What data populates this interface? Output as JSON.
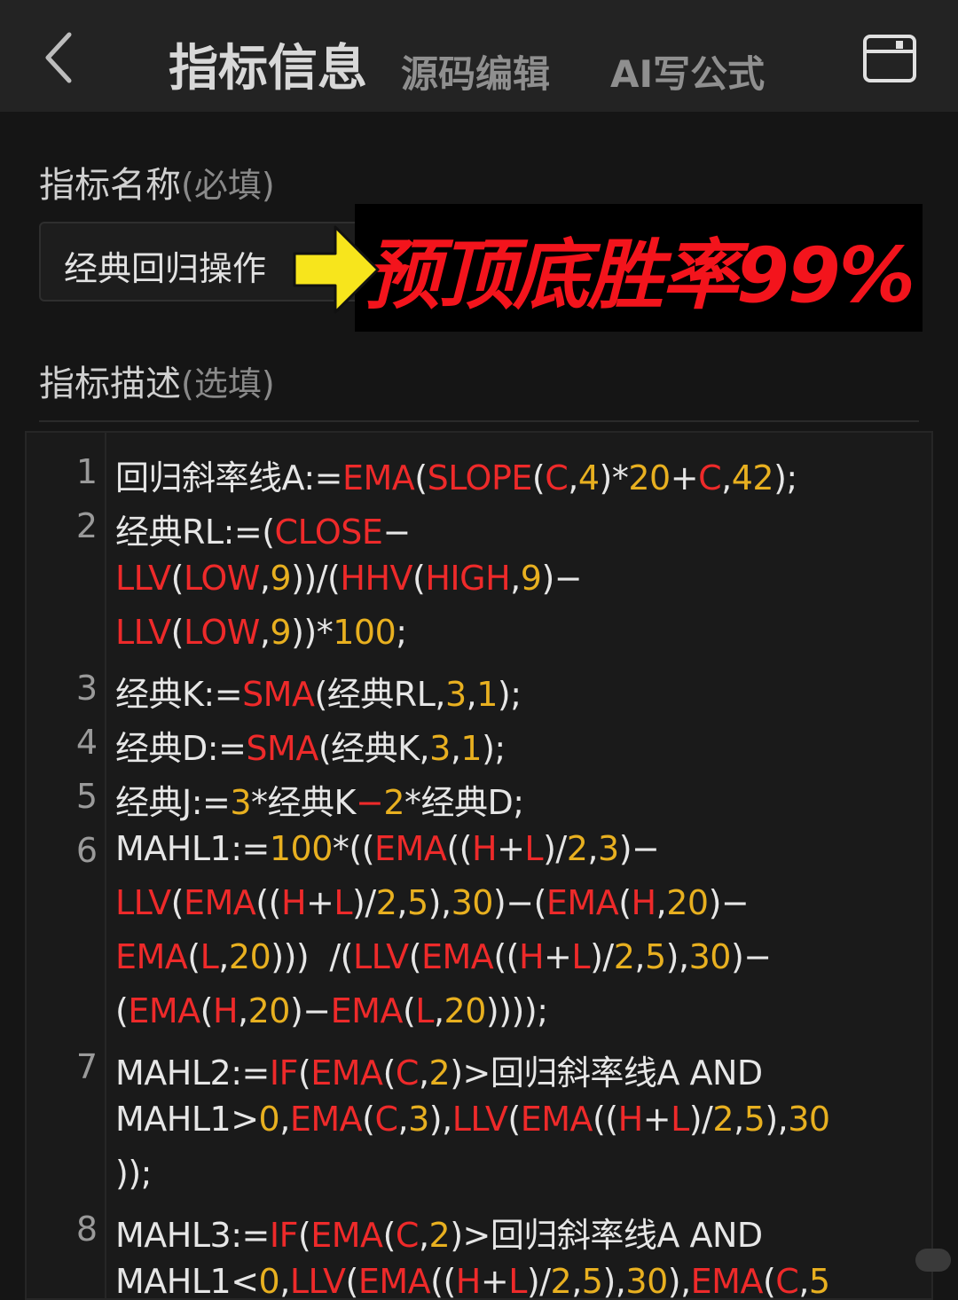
{
  "header": {
    "tabs": [
      "指标信息",
      "源码编辑",
      "AI写公式"
    ]
  },
  "form": {
    "name_label": "指标名称",
    "name_hint": "(必填)",
    "name_value": "经典回归操作",
    "desc_label": "指标描述",
    "desc_hint": "(选填)"
  },
  "banner": {
    "text": "预顶底胜率99%"
  },
  "colors": {
    "keyword": "#ee2a2a",
    "number": "#e8b020",
    "text": "#e6e6e6",
    "banner": "#f3141c",
    "arrow": "#f7e51c"
  },
  "code_lines": [
    {
      "ln": "1",
      "tokens": [
        [
          "w",
          "回归斜率线A:="
        ],
        [
          "r",
          "EMA"
        ],
        [
          "w",
          "("
        ],
        [
          "r",
          "SLOPE"
        ],
        [
          "w",
          "("
        ],
        [
          "r",
          "C"
        ],
        [
          "w",
          ","
        ],
        [
          "o",
          "4"
        ],
        [
          "w",
          ")*"
        ],
        [
          "o",
          "20"
        ],
        [
          "w",
          "+"
        ],
        [
          "r",
          "C"
        ],
        [
          "w",
          ","
        ],
        [
          "o",
          "42"
        ],
        [
          "w",
          ");"
        ]
      ]
    },
    {
      "ln": "2",
      "tokens": [
        [
          "w",
          "经典RL:=("
        ],
        [
          "r",
          "CLOSE"
        ],
        [
          "w",
          "−"
        ]
      ]
    },
    {
      "ln": "",
      "tokens": [
        [
          "r",
          "LLV"
        ],
        [
          "w",
          "("
        ],
        [
          "r",
          "LOW"
        ],
        [
          "w",
          ","
        ],
        [
          "o",
          "9"
        ],
        [
          "w",
          "))/("
        ],
        [
          "r",
          "HHV"
        ],
        [
          "w",
          "("
        ],
        [
          "r",
          "HIGH"
        ],
        [
          "w",
          ","
        ],
        [
          "o",
          "9"
        ],
        [
          "w",
          ")−"
        ]
      ]
    },
    {
      "ln": "",
      "tokens": [
        [
          "r",
          "LLV"
        ],
        [
          "w",
          "("
        ],
        [
          "r",
          "LOW"
        ],
        [
          "w",
          ","
        ],
        [
          "o",
          "9"
        ],
        [
          "w",
          "))*"
        ],
        [
          "o",
          "100"
        ],
        [
          "w",
          ";"
        ]
      ]
    },
    {
      "ln": "3",
      "tokens": [
        [
          "w",
          "经典K:="
        ],
        [
          "r",
          "SMA"
        ],
        [
          "w",
          "(经典RL,"
        ],
        [
          "o",
          "3"
        ],
        [
          "w",
          ","
        ],
        [
          "o",
          "1"
        ],
        [
          "w",
          ");"
        ]
      ]
    },
    {
      "ln": "4",
      "tokens": [
        [
          "w",
          "经典D:="
        ],
        [
          "r",
          "SMA"
        ],
        [
          "w",
          "(经典K,"
        ],
        [
          "o",
          "3"
        ],
        [
          "w",
          ","
        ],
        [
          "o",
          "1"
        ],
        [
          "w",
          ");"
        ]
      ]
    },
    {
      "ln": "5",
      "tokens": [
        [
          "w",
          "经典J:="
        ],
        [
          "o",
          "3"
        ],
        [
          "w",
          "*经典K"
        ],
        [
          "r",
          "−"
        ],
        [
          "o",
          "2"
        ],
        [
          "w",
          "*经典D;"
        ]
      ]
    },
    {
      "ln": "6",
      "tokens": [
        [
          "w",
          "MAHL1:="
        ],
        [
          "o",
          "100"
        ],
        [
          "w",
          "*(("
        ],
        [
          "r",
          "EMA"
        ],
        [
          "w",
          "(("
        ],
        [
          "r",
          "H"
        ],
        [
          "w",
          "+"
        ],
        [
          "r",
          "L"
        ],
        [
          "w",
          ")/"
        ],
        [
          "o",
          "2"
        ],
        [
          "w",
          ","
        ],
        [
          "o",
          "3"
        ],
        [
          "w",
          ")−"
        ]
      ]
    },
    {
      "ln": "",
      "tokens": [
        [
          "r",
          "LLV"
        ],
        [
          "w",
          "("
        ],
        [
          "r",
          "EMA"
        ],
        [
          "w",
          "(("
        ],
        [
          "r",
          "H"
        ],
        [
          "w",
          "+"
        ],
        [
          "r",
          "L"
        ],
        [
          "w",
          ")/"
        ],
        [
          "o",
          "2"
        ],
        [
          "w",
          ","
        ],
        [
          "o",
          "5"
        ],
        [
          "w",
          "),"
        ],
        [
          "o",
          "30"
        ],
        [
          "w",
          ")−("
        ],
        [
          "r",
          "EMA"
        ],
        [
          "w",
          "("
        ],
        [
          "r",
          "H"
        ],
        [
          "w",
          ","
        ],
        [
          "o",
          "20"
        ],
        [
          "w",
          ")−"
        ]
      ]
    },
    {
      "ln": "",
      "tokens": [
        [
          "r",
          "EMA"
        ],
        [
          "w",
          "("
        ],
        [
          "r",
          "L"
        ],
        [
          "w",
          ","
        ],
        [
          "o",
          "20"
        ],
        [
          "w",
          ")))  /("
        ],
        [
          "r",
          "LLV"
        ],
        [
          "w",
          "("
        ],
        [
          "r",
          "EMA"
        ],
        [
          "w",
          "(("
        ],
        [
          "r",
          "H"
        ],
        [
          "w",
          "+"
        ],
        [
          "r",
          "L"
        ],
        [
          "w",
          ")/"
        ],
        [
          "o",
          "2"
        ],
        [
          "w",
          ","
        ],
        [
          "o",
          "5"
        ],
        [
          "w",
          "),"
        ],
        [
          "o",
          "30"
        ],
        [
          "w",
          ")−"
        ]
      ]
    },
    {
      "ln": "",
      "tokens": [
        [
          "w",
          "("
        ],
        [
          "r",
          "EMA"
        ],
        [
          "w",
          "("
        ],
        [
          "r",
          "H"
        ],
        [
          "w",
          ","
        ],
        [
          "o",
          "20"
        ],
        [
          "w",
          ")−"
        ],
        [
          "r",
          "EMA"
        ],
        [
          "w",
          "("
        ],
        [
          "r",
          "L"
        ],
        [
          "w",
          ","
        ],
        [
          "o",
          "20"
        ],
        [
          "w",
          "))));"
        ]
      ]
    },
    {
      "ln": "7",
      "tokens": [
        [
          "w",
          "MAHL2:="
        ],
        [
          "r",
          "IF"
        ],
        [
          "w",
          "("
        ],
        [
          "r",
          "EMA"
        ],
        [
          "w",
          "("
        ],
        [
          "r",
          "C"
        ],
        [
          "w",
          ","
        ],
        [
          "o",
          "2"
        ],
        [
          "w",
          ")>回归斜率线A AND"
        ]
      ]
    },
    {
      "ln": "",
      "tokens": [
        [
          "w",
          "MAHL1>"
        ],
        [
          "o",
          "0"
        ],
        [
          "w",
          ","
        ],
        [
          "r",
          "EMA"
        ],
        [
          "w",
          "("
        ],
        [
          "r",
          "C"
        ],
        [
          "w",
          ","
        ],
        [
          "o",
          "3"
        ],
        [
          "w",
          "),"
        ],
        [
          "r",
          "LLV"
        ],
        [
          "w",
          "("
        ],
        [
          "r",
          "EMA"
        ],
        [
          "w",
          "(("
        ],
        [
          "r",
          "H"
        ],
        [
          "w",
          "+"
        ],
        [
          "r",
          "L"
        ],
        [
          "w",
          ")/"
        ],
        [
          "o",
          "2"
        ],
        [
          "w",
          ","
        ],
        [
          "o",
          "5"
        ],
        [
          "w",
          "),"
        ],
        [
          "o",
          "30"
        ]
      ]
    },
    {
      "ln": "",
      "tokens": [
        [
          "w",
          "));"
        ]
      ]
    },
    {
      "ln": "8",
      "tokens": [
        [
          "w",
          "MAHL3:="
        ],
        [
          "r",
          "IF"
        ],
        [
          "w",
          "("
        ],
        [
          "r",
          "EMA"
        ],
        [
          "w",
          "("
        ],
        [
          "r",
          "C"
        ],
        [
          "w",
          ","
        ],
        [
          "o",
          "2"
        ],
        [
          "w",
          ")>回归斜率线A AND"
        ]
      ]
    },
    {
      "ln": "",
      "tokens": [
        [
          "w",
          "MAHL1<"
        ],
        [
          "o",
          "0"
        ],
        [
          "w",
          ","
        ],
        [
          "r",
          "LLV"
        ],
        [
          "w",
          "("
        ],
        [
          "r",
          "EMA"
        ],
        [
          "w",
          "(("
        ],
        [
          "r",
          "H"
        ],
        [
          "w",
          "+"
        ],
        [
          "r",
          "L"
        ],
        [
          "w",
          ")/"
        ],
        [
          "o",
          "2"
        ],
        [
          "w",
          ","
        ],
        [
          "o",
          "5"
        ],
        [
          "w",
          "),"
        ],
        [
          "o",
          "30"
        ],
        [
          "w",
          "),"
        ],
        [
          "r",
          "EMA"
        ],
        [
          "w",
          "("
        ],
        [
          "r",
          "C"
        ],
        [
          "w",
          ","
        ],
        [
          "o",
          "5"
        ]
      ]
    }
  ]
}
